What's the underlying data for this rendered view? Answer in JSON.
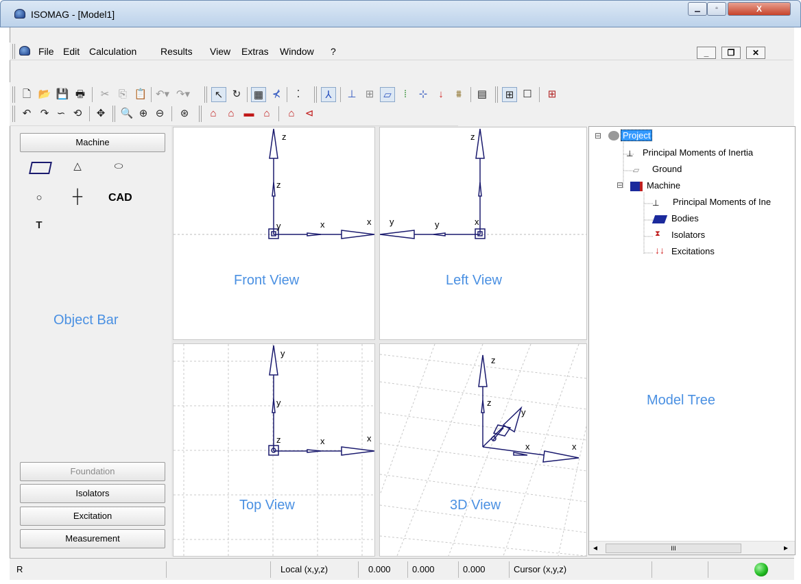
{
  "window": {
    "title": "ISOMAG - [Model1]"
  },
  "menu": {
    "items": [
      "File",
      "Edit",
      "Calculation",
      "Results",
      "View",
      "Extras",
      "Window",
      "?"
    ]
  },
  "object_bar": {
    "tabs": [
      "Machine",
      "Foundation",
      "Isolators",
      "Excitation",
      "Measurement"
    ],
    "cad_label": "CAD",
    "overlay_label": "Object Bar"
  },
  "views": {
    "front": "Front View",
    "left": "Left View",
    "top": "Top View",
    "three_d": "3D View"
  },
  "axes": {
    "x": "x",
    "y": "y",
    "z": "z"
  },
  "tree": {
    "overlay_label": "Model Tree",
    "nodes": [
      "Project",
      "Principal Moments of Inertia",
      "Ground",
      "Machine",
      "Principal Moments of Ine",
      "Bodies",
      "Isolators",
      "Excitations"
    ],
    "expander": "⊟"
  },
  "status": {
    "left": "R",
    "local_label": "Local (x,y,z)",
    "local_x": "0.000",
    "local_y": "0.000",
    "local_z": "0.000",
    "cursor_label": "Cursor (x,y,z)"
  },
  "scroll": {
    "left": "◂",
    "right": "▸",
    "thumb": "III"
  },
  "colors": {
    "accent_label": "#4a90e2",
    "axis": "#1a1a6e",
    "status_ok": "#22bb22"
  }
}
